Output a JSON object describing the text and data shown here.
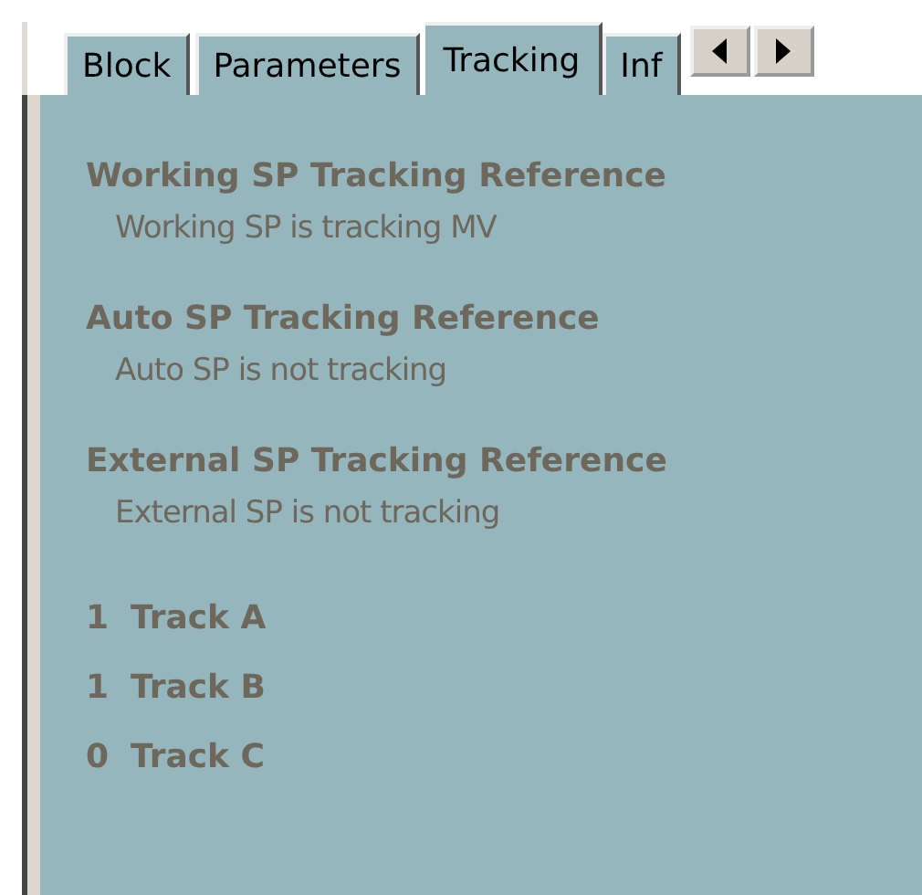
{
  "tabs": [
    {
      "label": "Block",
      "selected": false
    },
    {
      "label": "Parameters",
      "selected": false
    },
    {
      "label": "Tracking",
      "selected": true
    },
    {
      "label": "Inf",
      "selected": false
    }
  ],
  "sections": [
    {
      "heading": "Working SP Tracking Reference",
      "text": "Working SP is tracking MV"
    },
    {
      "heading": "Auto SP Tracking Reference",
      "text": "Auto SP is not tracking"
    },
    {
      "heading": "External SP Tracking Reference",
      "text": "External SP is not tracking"
    }
  ],
  "tracks": [
    {
      "value": "1",
      "label": "Track A"
    },
    {
      "value": "1",
      "label": "Track B"
    },
    {
      "value": "0",
      "label": "Track C"
    }
  ]
}
